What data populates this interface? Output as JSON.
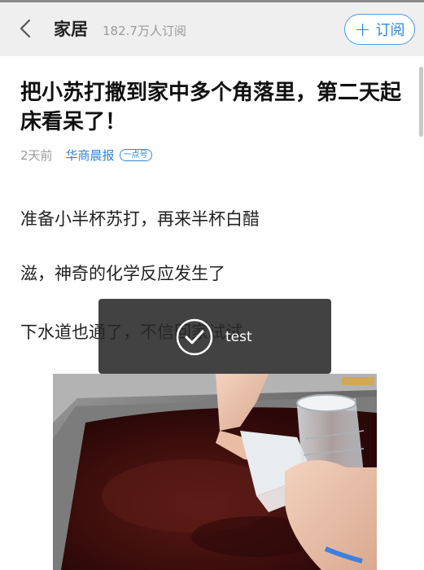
{
  "header": {
    "back_icon": "chevron-left-icon",
    "channel_title": "家居",
    "readers": "182.7万人订阅",
    "subscribe_icon": "plus-icon",
    "subscribe_plus": "+",
    "subscribe_label": "订阅",
    "accent_color": "#2f86d6"
  },
  "article": {
    "title": "把小苏打撒到家中多个角落里，第二天起床看呆了！",
    "time": "2天前",
    "source": "华商晨报",
    "badge": "一点号",
    "paragraphs": [
      "准备小半杯苏打，再来半杯白醋",
      "滋，神奇的化学反应发生了",
      "下水道也通了，不信回家试试"
    ]
  },
  "toast": {
    "icon": "check-circle-icon",
    "text": "test"
  }
}
